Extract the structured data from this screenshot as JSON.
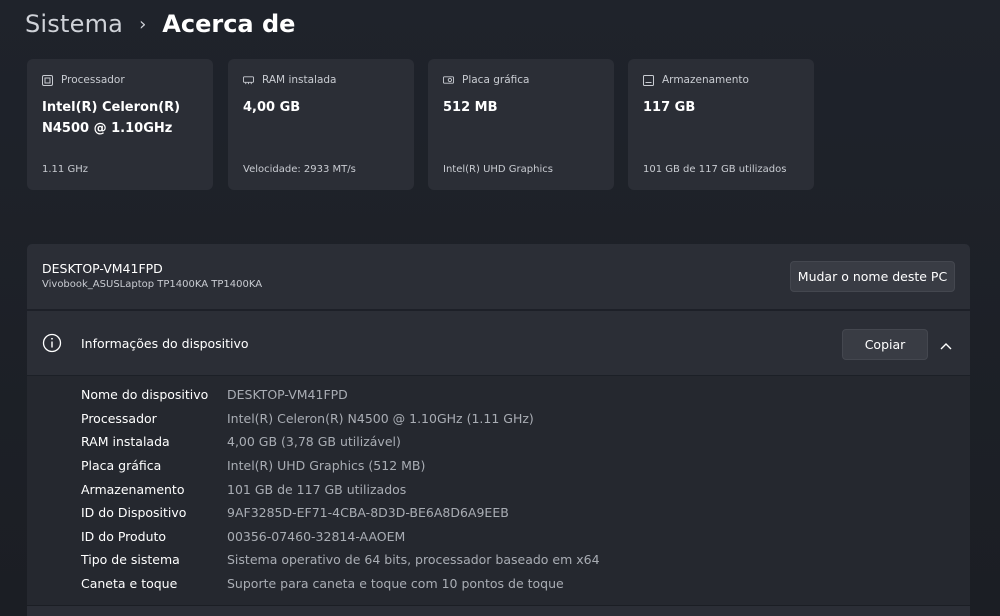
{
  "breadcrumb": {
    "parent": "Sistema",
    "separator": "›",
    "current": "Acerca de"
  },
  "cards": [
    {
      "label": "Processador",
      "value": "Intel(R) Celeron(R) N4500 @ 1.10GHz",
      "footer": "1.11 GHz",
      "icon": "cpu-icon"
    },
    {
      "label": "RAM instalada",
      "value": "4,00 GB",
      "footer": "Velocidade: 2933 MT/s",
      "icon": "ram-icon"
    },
    {
      "label": "Placa gráfica",
      "value": "512 MB",
      "footer": "Intel(R) UHD Graphics",
      "icon": "gpu-icon"
    },
    {
      "label": "Armazenamento",
      "value": "117 GB",
      "footer": "101 GB de 117 GB utilizados",
      "icon": "storage-icon"
    }
  ],
  "device": {
    "name": "DESKTOP-VM41FPD",
    "model": "Vivobook_ASUSLaptop TP1400KA TP1400KA",
    "rename_label": "Mudar o nome deste PC"
  },
  "info": {
    "title": "Informações do dispositivo",
    "copy_label": "Copiar",
    "rows": [
      {
        "label": "Nome do dispositivo",
        "value": "DESKTOP-VM41FPD"
      },
      {
        "label": "Processador",
        "value": "Intel(R) Celeron(R) N4500 @ 1.10GHz (1.11 GHz)"
      },
      {
        "label": "RAM instalada",
        "value": "4,00 GB (3,78 GB utilizável)"
      },
      {
        "label": "Placa gráfica",
        "value": "Intel(R) UHD Graphics (512 MB)"
      },
      {
        "label": "Armazenamento",
        "value": "101 GB de 117 GB utilizados"
      },
      {
        "label": "ID do Dispositivo",
        "value": "9AF3285D-EF71-4CBA-8D3D-BE6A8D6A9EEB"
      },
      {
        "label": "ID do Produto",
        "value": "00356-07460-32814-AAOEM"
      },
      {
        "label": "Tipo de sistema",
        "value": "Sistema operativo de 64 bits, processador baseado em x64"
      },
      {
        "label": "Caneta e toque",
        "value": "Suporte para caneta e toque com 10 pontos de toque"
      }
    ]
  },
  "colors": {
    "background": "#1c1f26",
    "card": "#2b2e36",
    "muted_text": "#a9adb4"
  }
}
